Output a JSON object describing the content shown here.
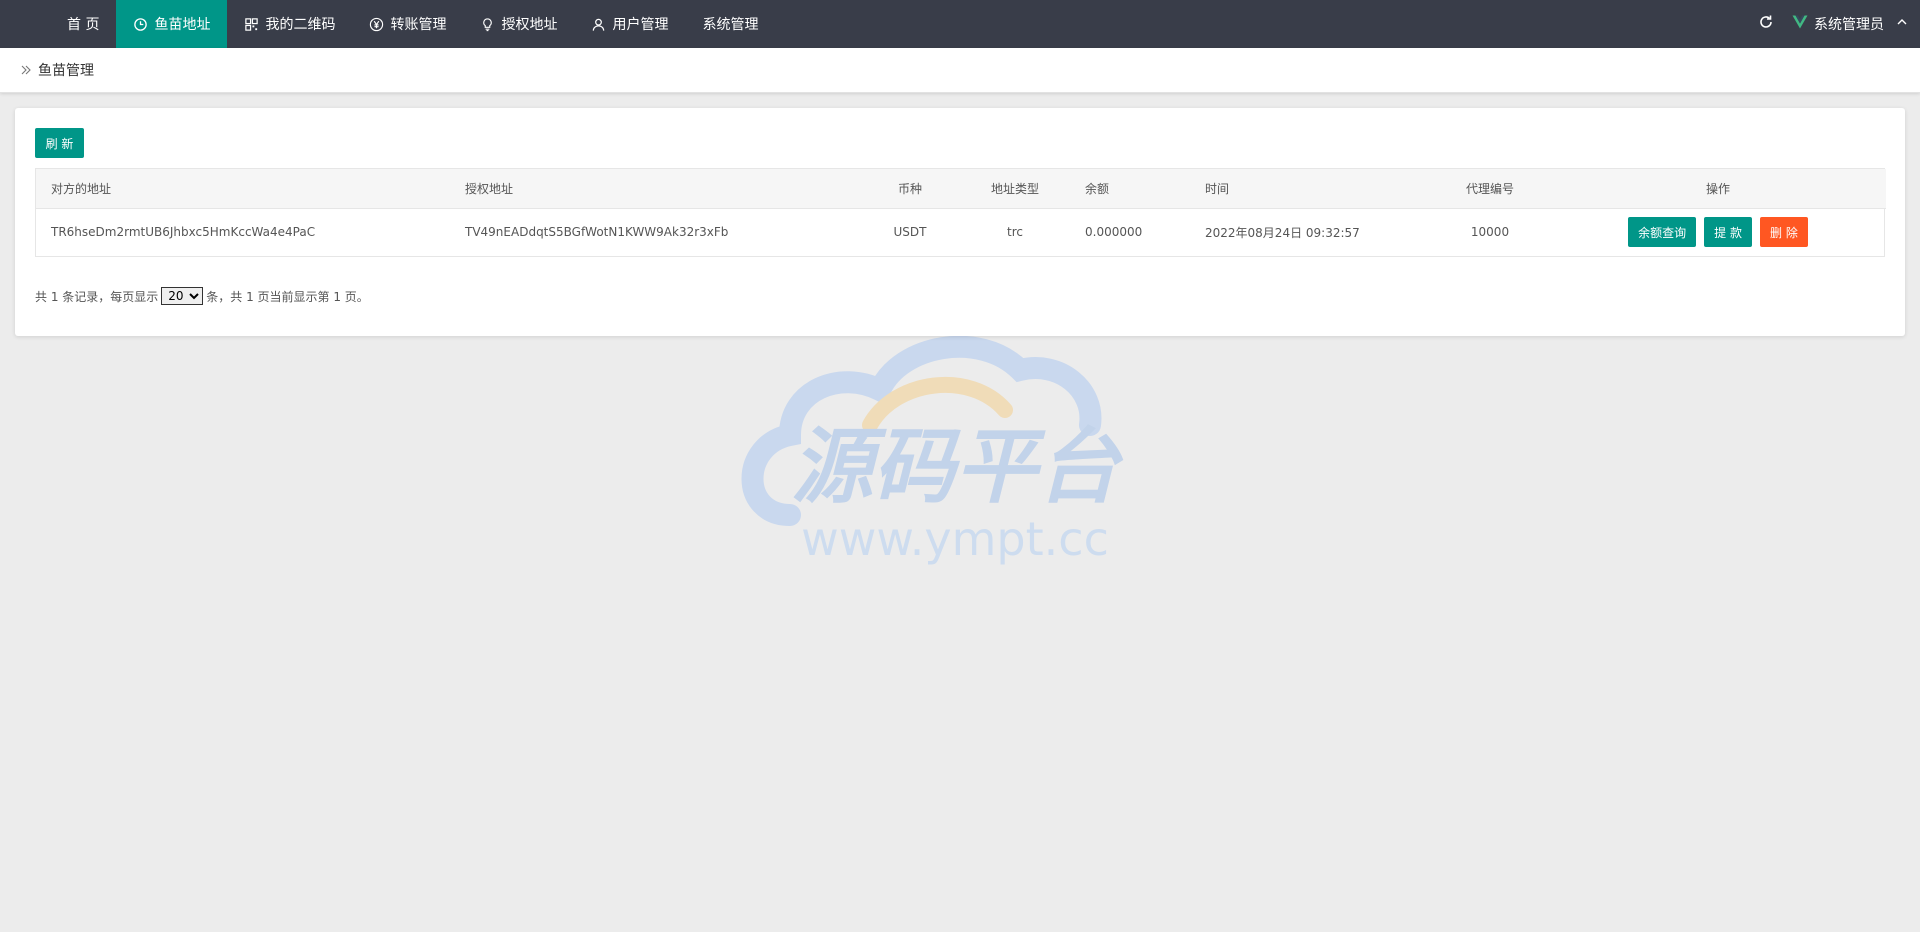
{
  "nav": {
    "items": [
      {
        "label": "首 页",
        "icon": ""
      },
      {
        "label": "鱼苗地址",
        "icon": "clock-icon",
        "active": true
      },
      {
        "label": "我的二维码",
        "icon": "qrcode-icon"
      },
      {
        "label": "转账管理",
        "icon": "yen-icon"
      },
      {
        "label": "授权地址",
        "icon": "lightbulb-icon"
      },
      {
        "label": "用户管理",
        "icon": "user-icon"
      },
      {
        "label": "系统管理",
        "icon": ""
      }
    ],
    "user": "系统管理员"
  },
  "breadcrumb": {
    "current": "鱼苗管理"
  },
  "toolbar": {
    "refresh_label": "刷 新"
  },
  "table": {
    "headers": [
      "对方的地址",
      "授权地址",
      "币种",
      "地址类型",
      "余额",
      "时间",
      "代理编号",
      "操作"
    ],
    "rows": [
      {
        "address": "TR6hseDm2rmtUB6Jhbxc5HmKccWa4e4PaC",
        "auth_address": "TV49nEADdqtS5BGfWotN1KWW9Ak32r3xFb",
        "currency": "USDT",
        "type": "trc",
        "balance": "0.000000",
        "time": "2022年08月24日 09:32:57",
        "agent": "10000",
        "actions": [
          "余额查询",
          "提 款",
          "删 除"
        ]
      }
    ]
  },
  "pager": {
    "prefix": "共 1 条记录，每页显示",
    "page_size": "20",
    "suffix": "条，共 1 页当前显示第 1 页。"
  },
  "colors": {
    "accent": "#009688",
    "danger": "#ff5722",
    "nav_bg": "#393d49"
  },
  "watermark": {
    "title": "源码平台",
    "url": "www.ympt.cc"
  }
}
